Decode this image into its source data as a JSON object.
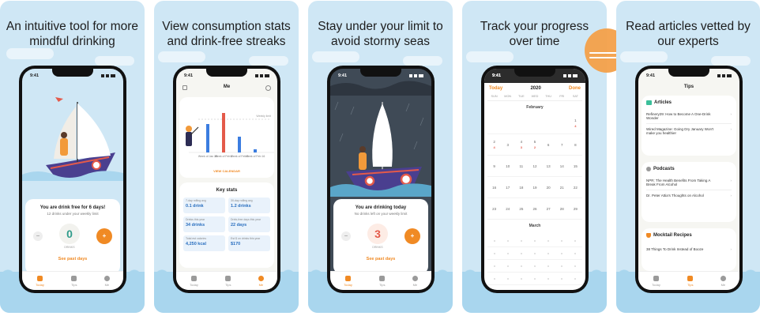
{
  "accent_color": "#f08a24",
  "sky_color": "#cfe7f5",
  "cards": [
    {
      "headline": "An intuitive tool for more mindful drinking",
      "time": "9:41",
      "panel_title": "You are drink free for 6 days!",
      "panel_sub": "12 drinks under your weekly limit",
      "counter": "0",
      "unit": "DRINKS",
      "see_past": "See past days",
      "tabs": [
        "Today",
        "Tips",
        "Me"
      ]
    },
    {
      "headline": "View consumption stats and drink-free streaks",
      "time": "9:41",
      "screen_title": "Me",
      "chart_weeks": [
        "Week of Jan 26",
        "Week of Feb 2",
        "Week of Feb 9",
        "Week of Feb 16"
      ],
      "chart_limit_label": "Weekly limit",
      "view_calendar": "VIEW CALENDAR",
      "stats_title": "Key stats",
      "stats": [
        {
          "label": "7-day rolling avg",
          "value": "0.1 drink"
        },
        {
          "label": "30-day rolling avg",
          "value": "1.2 drinks"
        },
        {
          "label": "Drinks this year",
          "value": "34 drinks"
        },
        {
          "label": "Drink-free days this year",
          "value": "22 days"
        },
        {
          "label": "Total est calories",
          "value": "4,250 kcal"
        },
        {
          "label": "Est $ on drinks this year",
          "value": "$170"
        }
      ],
      "tabs": [
        "Today",
        "Tips",
        "Me"
      ]
    },
    {
      "headline": "Stay under your limit to avoid stormy seas",
      "time": "9:41",
      "panel_title": "You are drinking today",
      "panel_sub": "No drinks left on your weekly limit",
      "counter": "3",
      "unit": "DRINKS",
      "see_past": "See past days",
      "tabs": [
        "Today",
        "Tips",
        "Me"
      ]
    },
    {
      "headline": "Track your progress over time",
      "time": "9:41",
      "cal_today": "Today",
      "cal_year": "2020",
      "cal_done": "Done",
      "weekdays": [
        "SUN",
        "MON",
        "TUE",
        "WED",
        "THU",
        "FRI",
        "SAT"
      ],
      "month1": "February",
      "month2": "March",
      "feb_rows": [
        [
          "",
          "",
          "",
          "",
          "",
          "",
          "1"
        ],
        [
          "2",
          "3",
          "4",
          "5",
          "6",
          "7",
          "8"
        ],
        [
          "9",
          "10",
          "11",
          "12",
          "13",
          "14",
          "15"
        ],
        [
          "16",
          "17",
          "18",
          "19",
          "20",
          "21",
          "22"
        ],
        [
          "23",
          "24",
          "25",
          "26",
          "27",
          "28",
          "29"
        ]
      ],
      "feb_marks": [
        [
          "",
          "",
          "",
          "",
          "",
          "",
          "4"
        ],
        [
          "4",
          "",
          "3",
          "2",
          "",
          "",
          ""
        ],
        [
          "",
          "",
          "",
          "",
          "",
          "",
          ""
        ],
        [
          "",
          "",
          "",
          "",
          "",
          "",
          ""
        ],
        [
          "",
          "",
          "",
          "",
          "",
          "",
          ""
        ]
      ]
    },
    {
      "headline": "Read articles vetted by our experts",
      "time": "9:41",
      "screen_title": "Tips",
      "sections": [
        {
          "title": "Articles",
          "items": [
            "Refinery29: How to Become A One-Drink Wonder",
            "Wired Magazine: Going Dry January Won't make you healthier"
          ]
        },
        {
          "title": "Podcasts",
          "items": [
            "NPR: The Health Benefits From Taking A Break From Alcohol",
            "Dr. Peter Attia's Thoughts on Alcohol"
          ]
        },
        {
          "title": "Mocktail Recipes",
          "items": [
            "38 Things To Drink Instead of Booze"
          ]
        }
      ],
      "tabs": [
        "Today",
        "Tips",
        "Me"
      ]
    }
  ]
}
